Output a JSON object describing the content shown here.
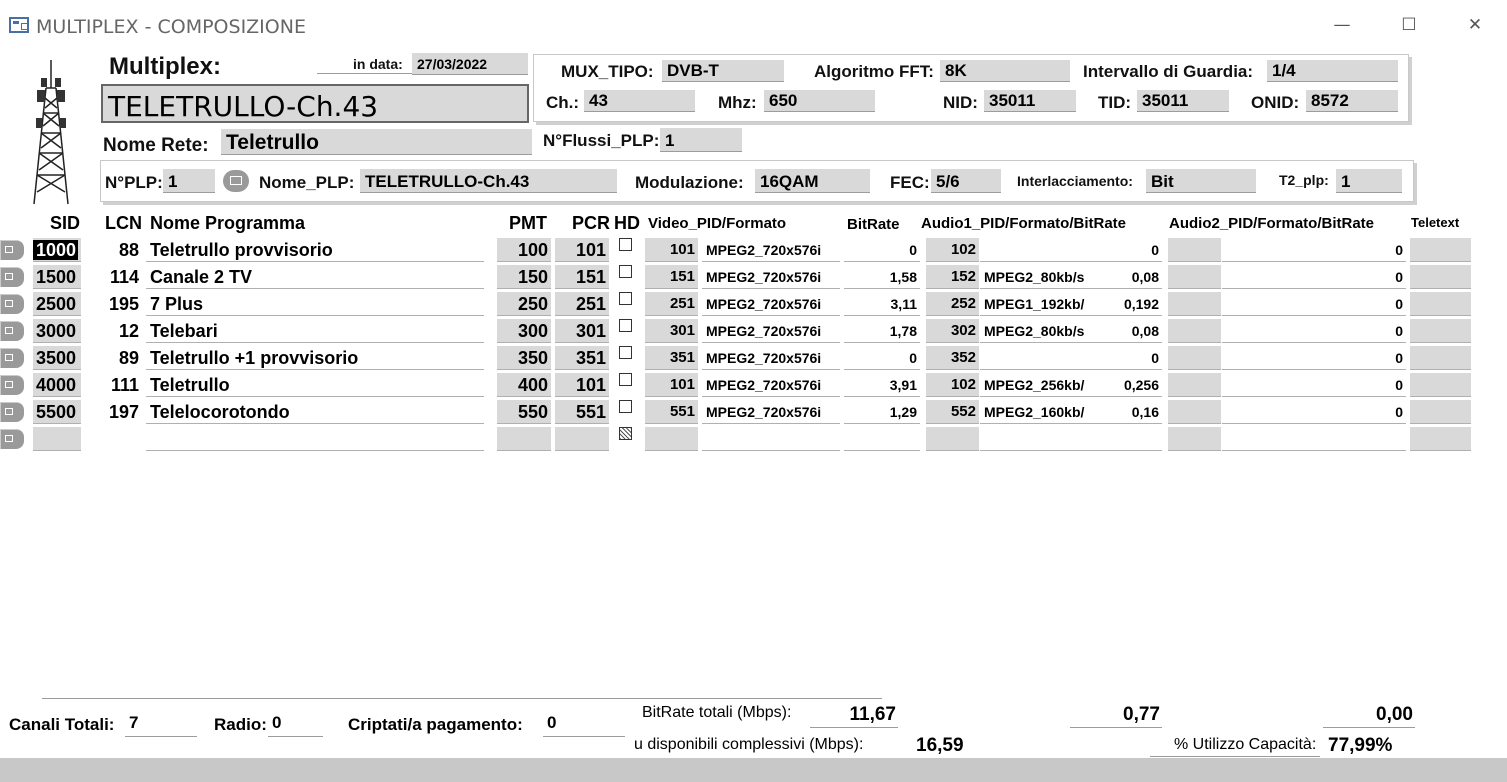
{
  "window": {
    "title": "MULTIPLEX - COMPOSIZIONE",
    "minimize": "—",
    "maximize": "☐",
    "close": "✕"
  },
  "form": {
    "multiplex_label": "Multiplex:",
    "in_data_label": "in data:",
    "in_data_value": "27/03/2022",
    "mux_name": "TELETRULLO-Ch.43",
    "nome_rete_label": "Nome Rete:",
    "nome_rete_value": "Teletrullo",
    "nflussi_label": "N°Flussi_PLP:",
    "nflussi_value": "1",
    "mux_tipo_label": "MUX_TIPO:",
    "mux_tipo_value": "DVB-T",
    "fft_label": "Algoritmo FFT:",
    "fft_value": "8K",
    "guardia_label": "Intervallo di Guardia:",
    "guardia_value": "1/4",
    "ch_label": "Ch.:",
    "ch_value": "43",
    "mhz_label": "Mhz:",
    "mhz_value": "650",
    "nid_label": "NID:",
    "nid_value": "35011",
    "tid_label": "TID:",
    "tid_value": "35011",
    "onid_label": "ONID:",
    "onid_value": "8572",
    "nplp_label": "N°PLP:",
    "nplp_value": "1",
    "nome_plp_label": "Nome_PLP:",
    "nome_plp_value": "TELETRULLO-Ch.43",
    "modulazione_label": "Modulazione:",
    "modulazione_value": "16QAM",
    "fec_label": "FEC:",
    "fec_value": "5/6",
    "interl_label": "Interlacciamento:",
    "interl_value": "Bit",
    "t2plp_label": "T2_plp:",
    "t2plp_value": "1"
  },
  "table": {
    "headers": {
      "sid": "SID",
      "lcn": "LCN",
      "nome": "Nome Programma",
      "pmt": "PMT",
      "pcr": "PCR",
      "hd": "HD",
      "video": "Video_PID/Formato",
      "bitrate": "BitRate",
      "audio1": "Audio1_PID/Formato/BitRate",
      "audio2": "Audio2_PID/Formato/BitRate",
      "teletext": "Teletext"
    },
    "rows": [
      {
        "sid": "1000",
        "lcn": "88",
        "nome": "Teletrullo provvisorio",
        "pmt": "100",
        "pcr": "101",
        "vpid": "101",
        "vfmt": "MPEG2_720x576i",
        "vbr": "0",
        "a1pid": "102",
        "a1fmt": "",
        "a1br": "0",
        "a2br": "0"
      },
      {
        "sid": "1500",
        "lcn": "114",
        "nome": "Canale 2 TV",
        "pmt": "150",
        "pcr": "151",
        "vpid": "151",
        "vfmt": "MPEG2_720x576i",
        "vbr": "1,58",
        "a1pid": "152",
        "a1fmt": "MPEG2_80kb/s",
        "a1br": "0,08",
        "a2br": "0"
      },
      {
        "sid": "2500",
        "lcn": "195",
        "nome": "7 Plus",
        "pmt": "250",
        "pcr": "251",
        "vpid": "251",
        "vfmt": "MPEG2_720x576i",
        "vbr": "3,11",
        "a1pid": "252",
        "a1fmt": "MPEG1_192kb/",
        "a1br": "0,192",
        "a2br": "0"
      },
      {
        "sid": "3000",
        "lcn": "12",
        "nome": "Telebari",
        "pmt": "300",
        "pcr": "301",
        "vpid": "301",
        "vfmt": "MPEG2_720x576i",
        "vbr": "1,78",
        "a1pid": "302",
        "a1fmt": "MPEG2_80kb/s",
        "a1br": "0,08",
        "a2br": "0"
      },
      {
        "sid": "3500",
        "lcn": "89",
        "nome": "Teletrullo +1 provvisorio",
        "pmt": "350",
        "pcr": "351",
        "vpid": "351",
        "vfmt": "MPEG2_720x576i",
        "vbr": "0",
        "a1pid": "352",
        "a1fmt": "",
        "a1br": "0",
        "a2br": "0"
      },
      {
        "sid": "4000",
        "lcn": "111",
        "nome": "Teletrullo",
        "pmt": "400",
        "pcr": "101",
        "vpid": "101",
        "vfmt": "MPEG2_720x576i",
        "vbr": "3,91",
        "a1pid": "102",
        "a1fmt": "MPEG2_256kb/",
        "a1br": "0,256",
        "a2br": "0"
      },
      {
        "sid": "5500",
        "lcn": "197",
        "nome": "Telelocorotondo",
        "pmt": "550",
        "pcr": "551",
        "vpid": "551",
        "vfmt": "MPEG2_720x576i",
        "vbr": "1,29",
        "a1pid": "552",
        "a1fmt": "MPEG2_160kb/",
        "a1br": "0,16",
        "a2br": "0"
      }
    ]
  },
  "footer": {
    "canali_label": "Canali Totali:",
    "canali_value": "7",
    "radio_label": "Radio:",
    "radio_value": "0",
    "criptati_label": "Criptati/a pagamento:",
    "criptati_value": "0",
    "bitrate_tot_label": "BitRate totali (Mbps):",
    "bitrate_video_tot": "11,67",
    "bitrate_audio1_tot": "0,77",
    "bitrate_audio2_tot": "0,00",
    "disponibili_label": "u disponibili complessivi (Mbps):",
    "disponibili_value": "16,59",
    "utilizzo_label": "% Utilizzo Capacità:",
    "utilizzo_value": "77,99%"
  }
}
